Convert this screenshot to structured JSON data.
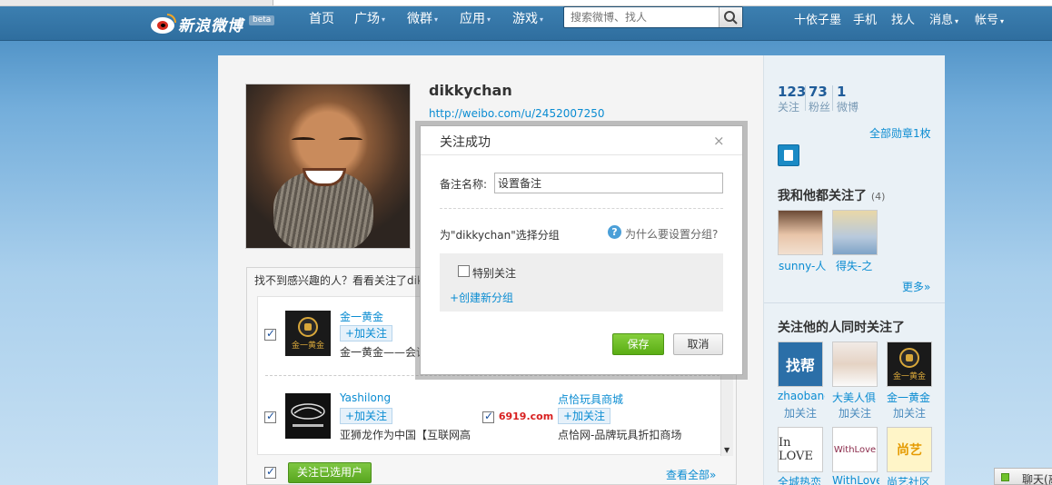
{
  "brand": {
    "name": "新浪微博",
    "beta": "beta"
  },
  "nav": {
    "items": [
      "首页",
      "广场",
      "微群",
      "应用",
      "游戏"
    ],
    "search_placeholder": "搜索微博、找人",
    "right": [
      "十依子墨",
      "手机",
      "找人",
      "消息",
      "帐号"
    ]
  },
  "profile": {
    "username": "dikkychan",
    "url": "http://weibo.com/u/2452007250"
  },
  "suggest": {
    "title": "找不到感兴趣的人？看看关注了dikkychan的人",
    "users": [
      {
        "name": "金一黄金",
        "follow": "+加关注",
        "desc": "金一黄金——会议",
        "logo": "金一黄金"
      },
      {
        "name": "Yashilong",
        "follow": "+加关注",
        "desc": "亚狮龙作为中国【互联网高"
      },
      {
        "name": "点恰玩具商城",
        "follow": "+加关注",
        "desc": "点恰网-品牌玩具折扣商场",
        "logo": "6919.com"
      }
    ],
    "follow_selected": "关注已选用户",
    "view_all": "查看全部»"
  },
  "side": {
    "stats": [
      {
        "num": "123",
        "label": "关注"
      },
      {
        "num": "73",
        "label": "粉丝"
      },
      {
        "num": "1",
        "label": "微博"
      }
    ],
    "medals": "全部勋章1枚",
    "common_title": "我和他都关注了",
    "common_count": "(4)",
    "common_users": [
      "sunny-人",
      "得失-之"
    ],
    "more": "更多»",
    "also_title": "关注他的人同时关注了",
    "also_users": [
      {
        "name": "zhaobang",
        "follow": "加关注",
        "img_text": "找帮"
      },
      {
        "name": "大美人俱",
        "follow": "加关注"
      },
      {
        "name": "金一黄金",
        "follow": "加关注",
        "img_text": "金一黄金"
      }
    ],
    "row3": [
      {
        "name": "全城热恋",
        "img_text": "In LOVE"
      },
      {
        "name": "WithLove",
        "img_text": "WithLove"
      },
      {
        "name": "尚艺社区",
        "img_text": "尚艺"
      }
    ]
  },
  "dialog": {
    "title": "关注成功",
    "close": "×",
    "remark_label": "备注名称:",
    "remark_value": "设置备注",
    "group_prompt": "为\"dikkychan\"选择分组",
    "help_icon": "?",
    "help_text": "为什么要设置分组?",
    "special_follow": "特别关注",
    "new_group": "+创建新分组",
    "save": "保存",
    "cancel": "取消"
  },
  "chat": {
    "label": "聊天(离"
  },
  "colors": {
    "accent": "#0a8cd2",
    "green": "#5aad14",
    "nav": "#2f6e9f"
  }
}
